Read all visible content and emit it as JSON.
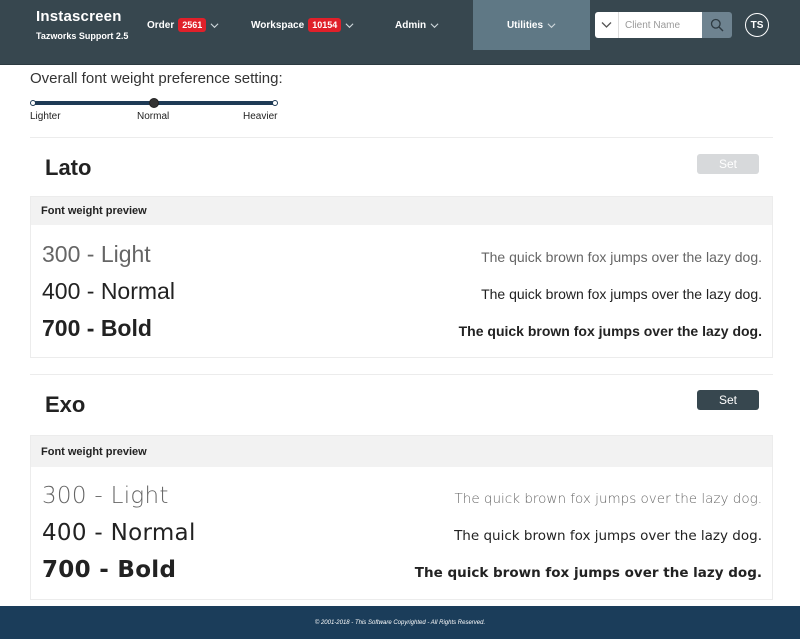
{
  "navbar": {
    "brand_title": "Instascreen",
    "brand_subtitle": "Tazworks Support 2.5",
    "items": [
      {
        "label": "Order",
        "badge": "2561"
      },
      {
        "label": "Workspace",
        "badge": "10154"
      },
      {
        "label": "Admin"
      },
      {
        "label": "Utilities"
      }
    ],
    "search": {
      "placeholder": "Client Name"
    },
    "avatar_initials": "TS",
    "colors": {
      "bar": "#37474f",
      "active": "#5f7885",
      "badge": "#e0202a"
    }
  },
  "preference": {
    "title": "Overall font weight preference setting:",
    "slider": {
      "labels": [
        "Lighter",
        "Normal",
        "Heavier"
      ],
      "selected": "Normal"
    }
  },
  "fonts": [
    {
      "name": "Lato",
      "set_label": "Set",
      "set_enabled": false,
      "preview_header": "Font weight preview",
      "rows": [
        {
          "weight_label": "300 - Light",
          "sample": "The quick brown fox jumps over the lazy dog."
        },
        {
          "weight_label": "400 - Normal",
          "sample": "The quick brown fox jumps over the lazy dog."
        },
        {
          "weight_label": "700 - Bold",
          "sample": "The quick brown fox jumps over the lazy dog."
        }
      ]
    },
    {
      "name": "Exo",
      "set_label": "Set",
      "set_enabled": true,
      "preview_header": "Font weight preview",
      "rows": [
        {
          "weight_label": "300 - Light",
          "sample": "The quick brown fox jumps over the lazy dog."
        },
        {
          "weight_label": "400 - Normal",
          "sample": "The quick brown fox jumps over the lazy dog."
        },
        {
          "weight_label": "700 - Bold",
          "sample": "The quick brown fox jumps over the lazy dog."
        }
      ]
    }
  ],
  "footer": {
    "text": "© 2001-2018 - This Software Copyrighted - All Rights Reserved.",
    "color": "#1b3d5a"
  }
}
